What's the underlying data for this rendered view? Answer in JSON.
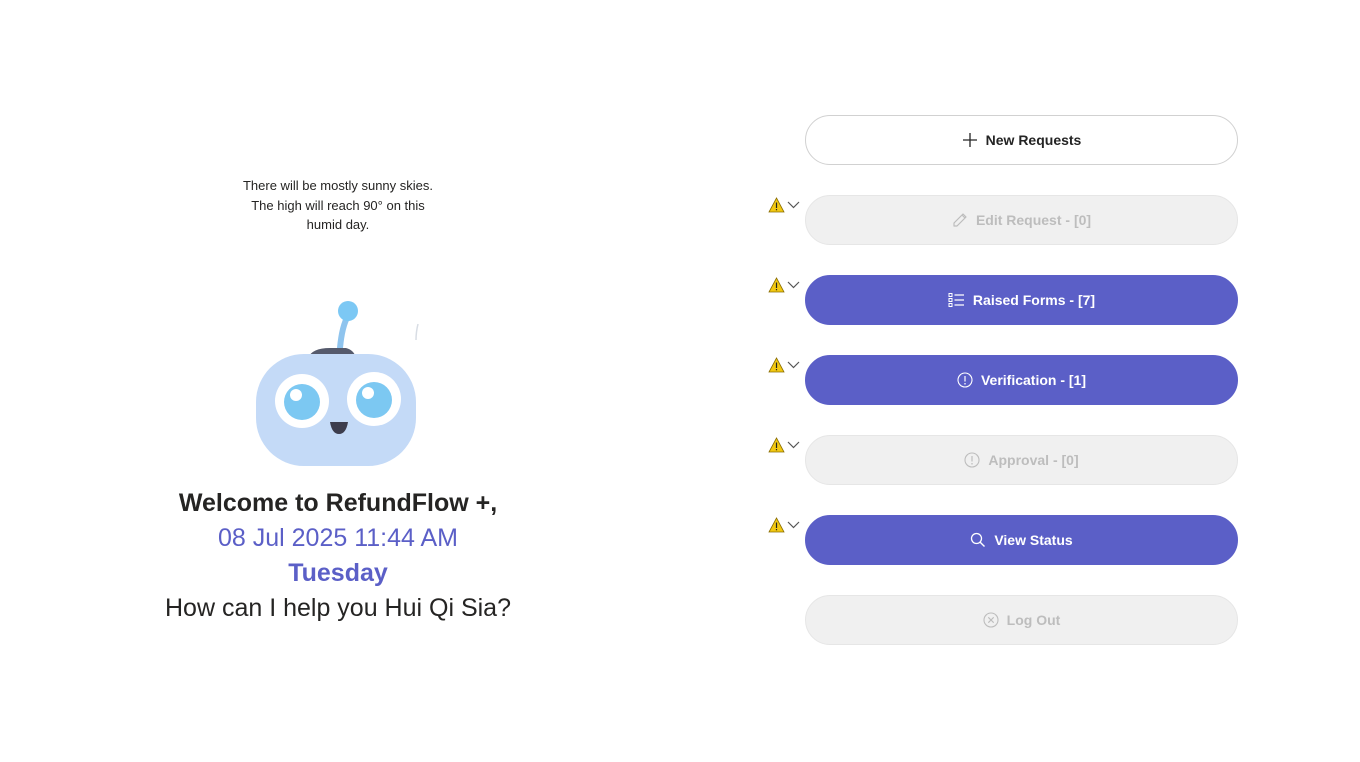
{
  "weather": {
    "line1": "There will be mostly sunny skies.",
    "line2": "The high will reach 90° on this",
    "line3": "humid day."
  },
  "greeting": {
    "welcome": "Welcome to RefundFlow +,",
    "datetime": "08 Jul 2025 11:44 AM",
    "weekday": "Tuesday",
    "question": "How can I help you Hui Qi Sia?"
  },
  "menu": {
    "new_requests": {
      "label": "New Requests",
      "icon": "plus-icon",
      "state": "enabled"
    },
    "edit_request": {
      "label": "Edit Request - [0]",
      "icon": "pencil-icon",
      "state": "disabled"
    },
    "raised_forms": {
      "label": "Raised Forms - [7]",
      "icon": "list-icon",
      "state": "enabled"
    },
    "verification": {
      "label": "Verification - [1]",
      "icon": "info-circle-icon",
      "state": "enabled"
    },
    "approval": {
      "label": "Approval - [0]",
      "icon": "info-circle-icon",
      "state": "disabled"
    },
    "view_status": {
      "label": "View Status",
      "icon": "search-icon",
      "state": "enabled"
    },
    "log_out": {
      "label": "Log Out",
      "icon": "close-circle-icon",
      "state": "disabled"
    }
  },
  "colors": {
    "accent": "#5b5fc7",
    "disabled_bg": "#f0f0f0",
    "disabled_text": "#bdbdbd",
    "warning": "#f2c811"
  }
}
